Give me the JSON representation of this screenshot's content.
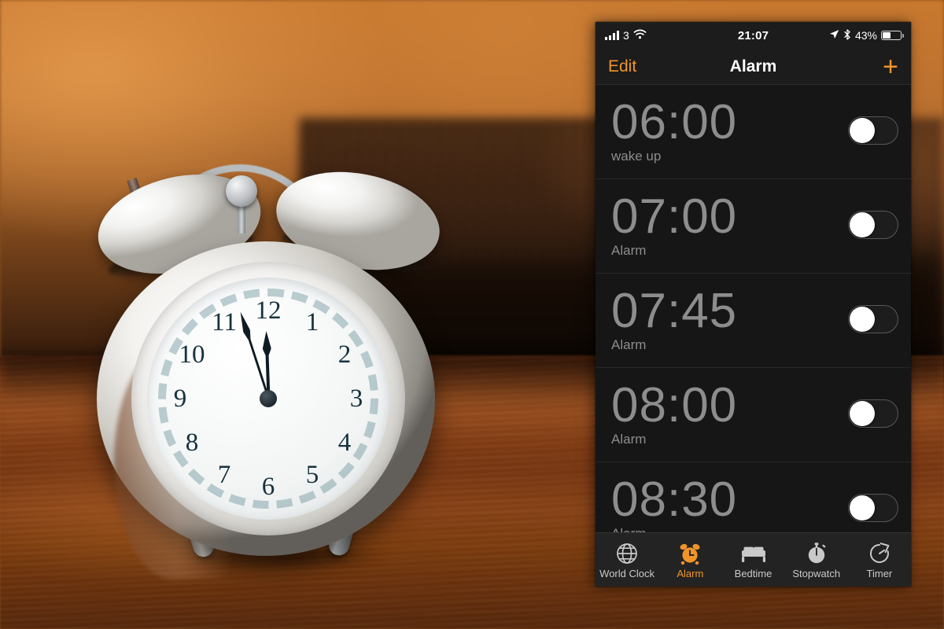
{
  "background_photo": {
    "description": "white twin-bell alarm clock on a wooden table with a dark leather sofa and warm orange blurred background",
    "clock_face_numerals": [
      "12",
      "1",
      "2",
      "3",
      "4",
      "5",
      "6",
      "7",
      "8",
      "9",
      "10",
      "11"
    ],
    "clock_time_shown": "11:57",
    "colors": {
      "wall_orange": "#c9792f",
      "table_wood": "#8a4116",
      "sofa_dark": "#3a2010",
      "clock_white": "#ffffff",
      "numeral_ink": "#16323d"
    }
  },
  "phone": {
    "status_bar": {
      "carrier": "3",
      "signal_icon": "signal-bars-icon",
      "wifi_icon": "wifi-icon",
      "time": "21:07",
      "location_icon": "location-arrow-icon",
      "bluetooth_icon": "bluetooth-icon",
      "battery_percent": "43%",
      "battery_level": 43,
      "battery_icon": "battery-icon"
    },
    "nav_bar": {
      "edit_label": "Edit",
      "title": "Alarm",
      "add_label": "+",
      "add_icon": "plus-icon",
      "accent_color": "#f0952a"
    },
    "alarms": [
      {
        "time": "06:00",
        "label": "wake up",
        "enabled": false
      },
      {
        "time": "07:00",
        "label": "Alarm",
        "enabled": false
      },
      {
        "time": "07:45",
        "label": "Alarm",
        "enabled": false
      },
      {
        "time": "08:00",
        "label": "Alarm",
        "enabled": false
      },
      {
        "time": "08:30",
        "label": "Alarm",
        "enabled": false
      }
    ],
    "tab_bar": {
      "active_index": 1,
      "tabs": [
        {
          "label": "World Clock",
          "icon": "globe-icon"
        },
        {
          "label": "Alarm",
          "icon": "alarm-clock-icon"
        },
        {
          "label": "Bedtime",
          "icon": "bed-icon"
        },
        {
          "label": "Stopwatch",
          "icon": "stopwatch-icon"
        },
        {
          "label": "Timer",
          "icon": "timer-icon"
        }
      ]
    }
  }
}
